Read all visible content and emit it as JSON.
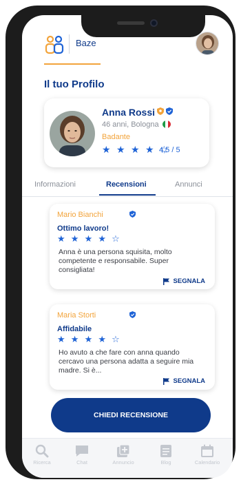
{
  "header": {
    "brand": "Baze",
    "logo_icon": "people-icon"
  },
  "profile": {
    "section_title": "Il tuo Profilo",
    "name": "Anna Rossi",
    "meta": "46 anni, Bologna",
    "role": "Badante",
    "stars": "★ ★ ★ ★ ☆",
    "rating": "4,5 / 5"
  },
  "tabs": [
    {
      "label": "Informazioni",
      "active": false
    },
    {
      "label": "Recensioni",
      "active": true
    },
    {
      "label": "Annunci",
      "active": false
    }
  ],
  "reviews": [
    {
      "author": "Mario Bianchi",
      "title": "Ottimo lavoro!",
      "stars": "★ ★ ★ ★ ☆",
      "body": "Anna è una persona squisita, molto competente e responsabile. Super consigliata!",
      "report_label": "SEGNALA"
    },
    {
      "author": "Maria Storti",
      "title": "Affidabile",
      "stars": "★ ★ ★ ★ ☆",
      "body": "Ho avuto a che fare con anna quando cercavo una persona adatta a seguire mia madre. Si è...",
      "report_label": "SEGNALA"
    }
  ],
  "cta": {
    "label": "CHIEDI RECENSIONE"
  },
  "nav": [
    {
      "label": "Ricerca",
      "icon": "search-icon"
    },
    {
      "label": "Chat",
      "icon": "chat-icon"
    },
    {
      "label": "Annuncio",
      "icon": "add-listing-icon"
    },
    {
      "label": "Blog",
      "icon": "blog-icon"
    },
    {
      "label": "Calendario",
      "icon": "calendar-icon"
    }
  ],
  "colors": {
    "primary": "#0f3a8a",
    "accent": "#f2a33a",
    "star": "#1f63d6"
  }
}
